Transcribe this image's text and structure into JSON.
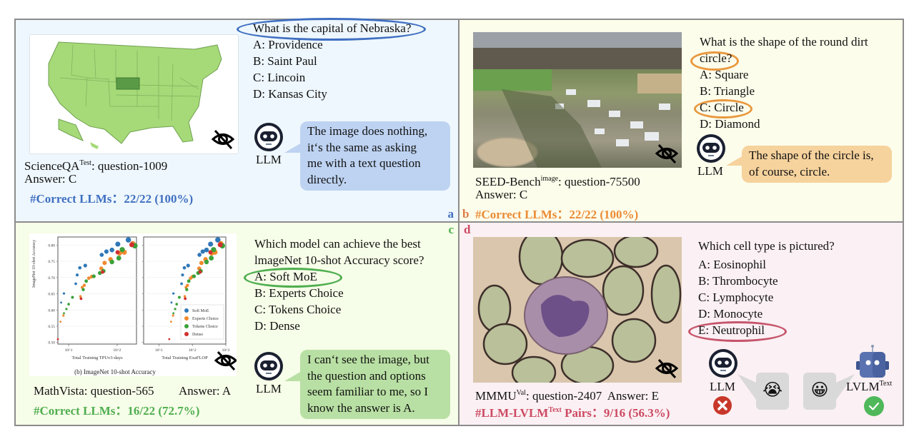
{
  "figure": {
    "panels": {
      "a": {
        "tag": "a",
        "color": "#3f6fc1",
        "question": "What is the capital of Nebraska?",
        "options": [
          "A: Providence",
          "B: Saint Paul",
          "C: Lincoin",
          "D: Kansas City"
        ],
        "agent_label": "LLM",
        "response_lines": [
          "The image does nothing,",
          "it‘s the same as asking",
          "me with a text question",
          "directly."
        ],
        "source_name": "ScienceQA",
        "source_sup": "Test",
        "source_rest": ": question-1009",
        "answer": "Answer: C",
        "stat": "#Correct LLMs：22/22 (100%)",
        "image_desc": "US map with Nebraska highlighted",
        "hidden_icon": "eye-slash-icon"
      },
      "b": {
        "tag": "b",
        "color": "#ea8a35",
        "question_line1": "What is the shape of the round dirt",
        "question_line2": "circle?",
        "options": [
          "A: Square",
          "B: Triangle",
          "C: Circle",
          "D: Diamond"
        ],
        "agent_label": "LLM",
        "response_lines": [
          "The shape of the circle is,",
          "of course, circle."
        ],
        "source_name": "SEED-Bench",
        "source_sup": "image",
        "source_rest": ": question-75500",
        "answer": "Answer: C",
        "stat": "#Correct LLMs：22/22 (100%)",
        "image_desc": "Aerial photo of a village with a round dirt circle",
        "hidden_icon": "eye-slash-icon"
      },
      "c": {
        "tag": "c",
        "color": "#4fae4f",
        "question_line1": "Which model can achieve the best",
        "question_line2": "lmageNet 10-shot Accuracy score?",
        "options": [
          "A: Soft MoE",
          "B: Experts Choice",
          "C: Tokens Choice",
          "D: Dense"
        ],
        "agent_label": "LLM",
        "response_lines": [
          "I can‘t see the image, but",
          "the question and options",
          "seem familiar to me, so I",
          "know the answer is A."
        ],
        "source": "MathVista: question-565",
        "answer": "Answer: A",
        "stat": "#Correct LLMs：16/22 (72.7%)",
        "chart_caption": "(b) ImageNet 10-shot Accuracy",
        "hidden_icon": "eye-slash-icon"
      },
      "d": {
        "tag": "d",
        "color": "#cc4a62",
        "question": "Which cell type is pictured?",
        "options": [
          "A: Eosinophil",
          "B: Thrombocyte",
          "C: Lymphocyte",
          "D: Monocyte",
          "E: Neutrophil"
        ],
        "agent_label": "LLM",
        "agent2_label": "LVLM",
        "agent2_sup": "Text",
        "emoji_sad": "😭",
        "emoji_happy": "😀",
        "source_name": "MMMU",
        "source_sup": "Val",
        "source_rest": ": question-2407  Answer: E",
        "stat_name": "#LLM-LVLM",
        "stat_sup": "Text",
        "stat_rest": " Pairs：9/16 (56.3%)",
        "image_desc": "Microscope image of a blood cell",
        "hidden_icon": "eye-slash-icon"
      }
    }
  },
  "chart_data": {
    "type": "scatter",
    "title": "(b) ImageNet 10-shot Accuracy",
    "subplots": [
      {
        "xlabel": "Total Training TPUv3-days",
        "xscale": "log",
        "xlim": [
          6,
          250
        ],
        "xticks": [
          "10^1",
          "10^2"
        ]
      },
      {
        "xlabel": "Total Training ExaFLOP",
        "xscale": "log",
        "xlim": [
          3.5,
          1000
        ],
        "xticks": [
          "10^1",
          "10^2",
          "10^3"
        ]
      }
    ],
    "ylabel": "ImageNet 10-shot Accuracy",
    "ylim": [
      0.495,
      0.825
    ],
    "yticks": [
      0.5,
      0.55,
      0.6,
      0.65,
      0.7,
      0.75,
      0.8
    ],
    "legend": [
      "Soft MoE",
      "Experts Choice",
      "Tokens Choice",
      "Dense"
    ],
    "legend_position": "lower-right",
    "colors": {
      "Soft MoE": "#2f78b8",
      "Experts Choice": "#f0892e",
      "Tokens Choice": "#3aa13a",
      "Dense": "#d0302f"
    },
    "series": [
      {
        "name": "Soft MoE",
        "x1": [
          7,
          8,
          14,
          15,
          17,
          22,
          48,
          60,
          78,
          103,
          170
        ],
        "y": [
          0.623,
          0.651,
          0.681,
          0.708,
          0.73,
          0.737,
          0.77,
          0.78,
          0.785,
          0.803,
          0.816
        ]
      },
      {
        "name": "Experts Choice",
        "x1": [
          6.8,
          7.8,
          17.5,
          19,
          21,
          26,
          30,
          47,
          55,
          73,
          112,
          140,
          210
        ],
        "y": [
          0.564,
          0.583,
          0.642,
          0.67,
          0.676,
          0.698,
          0.703,
          0.728,
          0.745,
          0.756,
          0.775,
          0.778,
          0.804
        ]
      },
      {
        "name": "Tokens Choice",
        "x1": [
          8,
          9,
          10,
          12,
          20,
          23,
          33,
          44,
          52,
          78,
          108,
          127,
          232
        ],
        "y": [
          0.59,
          0.603,
          0.618,
          0.639,
          0.663,
          0.689,
          0.704,
          0.714,
          0.72,
          0.748,
          0.76,
          0.786,
          0.798
        ]
      },
      {
        "name": "Dense",
        "x1": [
          6,
          18,
          50,
          102,
          200
        ],
        "y": [
          0.51,
          0.635,
          0.717,
          0.778,
          0.801
        ]
      }
    ]
  }
}
